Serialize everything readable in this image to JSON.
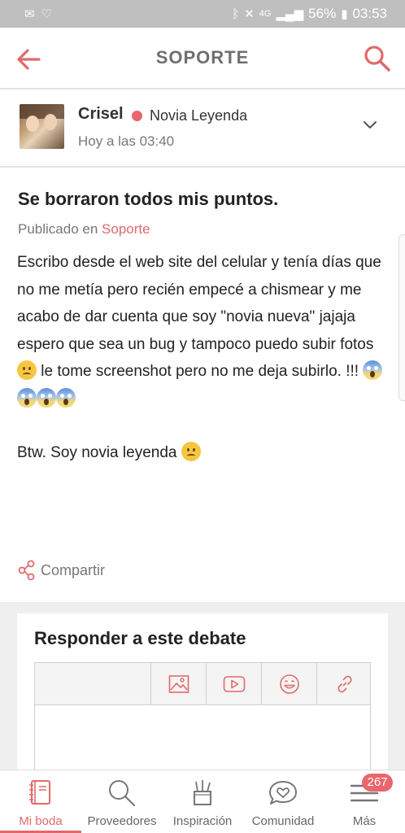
{
  "status_bar": {
    "battery": "56%",
    "time": "03:53",
    "network": "4G"
  },
  "header": {
    "title": "SOPORTE"
  },
  "author": {
    "name": "Crisel",
    "rank": "Novia Leyenda",
    "time": "Hoy a las 03:40"
  },
  "post": {
    "title": "Se borraron todos mis puntos.",
    "published_prefix": "Publicado en",
    "category": "Soporte",
    "p1_a": "Escribo desde el web site del celular y tenía días que no me metía pero recién empecé a chismear y me acabo de dar cuenta que soy \"novia nueva\" jajaja espero que sea un bug y tampoco puedo subir fotos",
    "p1_b": "le tome screenshot pero no me deja subirlo. !!!",
    "p2": "Btw. Soy novia leyenda"
  },
  "share": {
    "label": "Compartir"
  },
  "reply": {
    "title": "Responder a este debate"
  },
  "nav": {
    "items": [
      {
        "label": "Mi boda"
      },
      {
        "label": "Proveedores"
      },
      {
        "label": "Inspiración"
      },
      {
        "label": "Comunidad"
      },
      {
        "label": "Más"
      }
    ],
    "badge": "267"
  },
  "colors": {
    "accent": "#e06a6a",
    "rank_dot": "#e8666c"
  }
}
